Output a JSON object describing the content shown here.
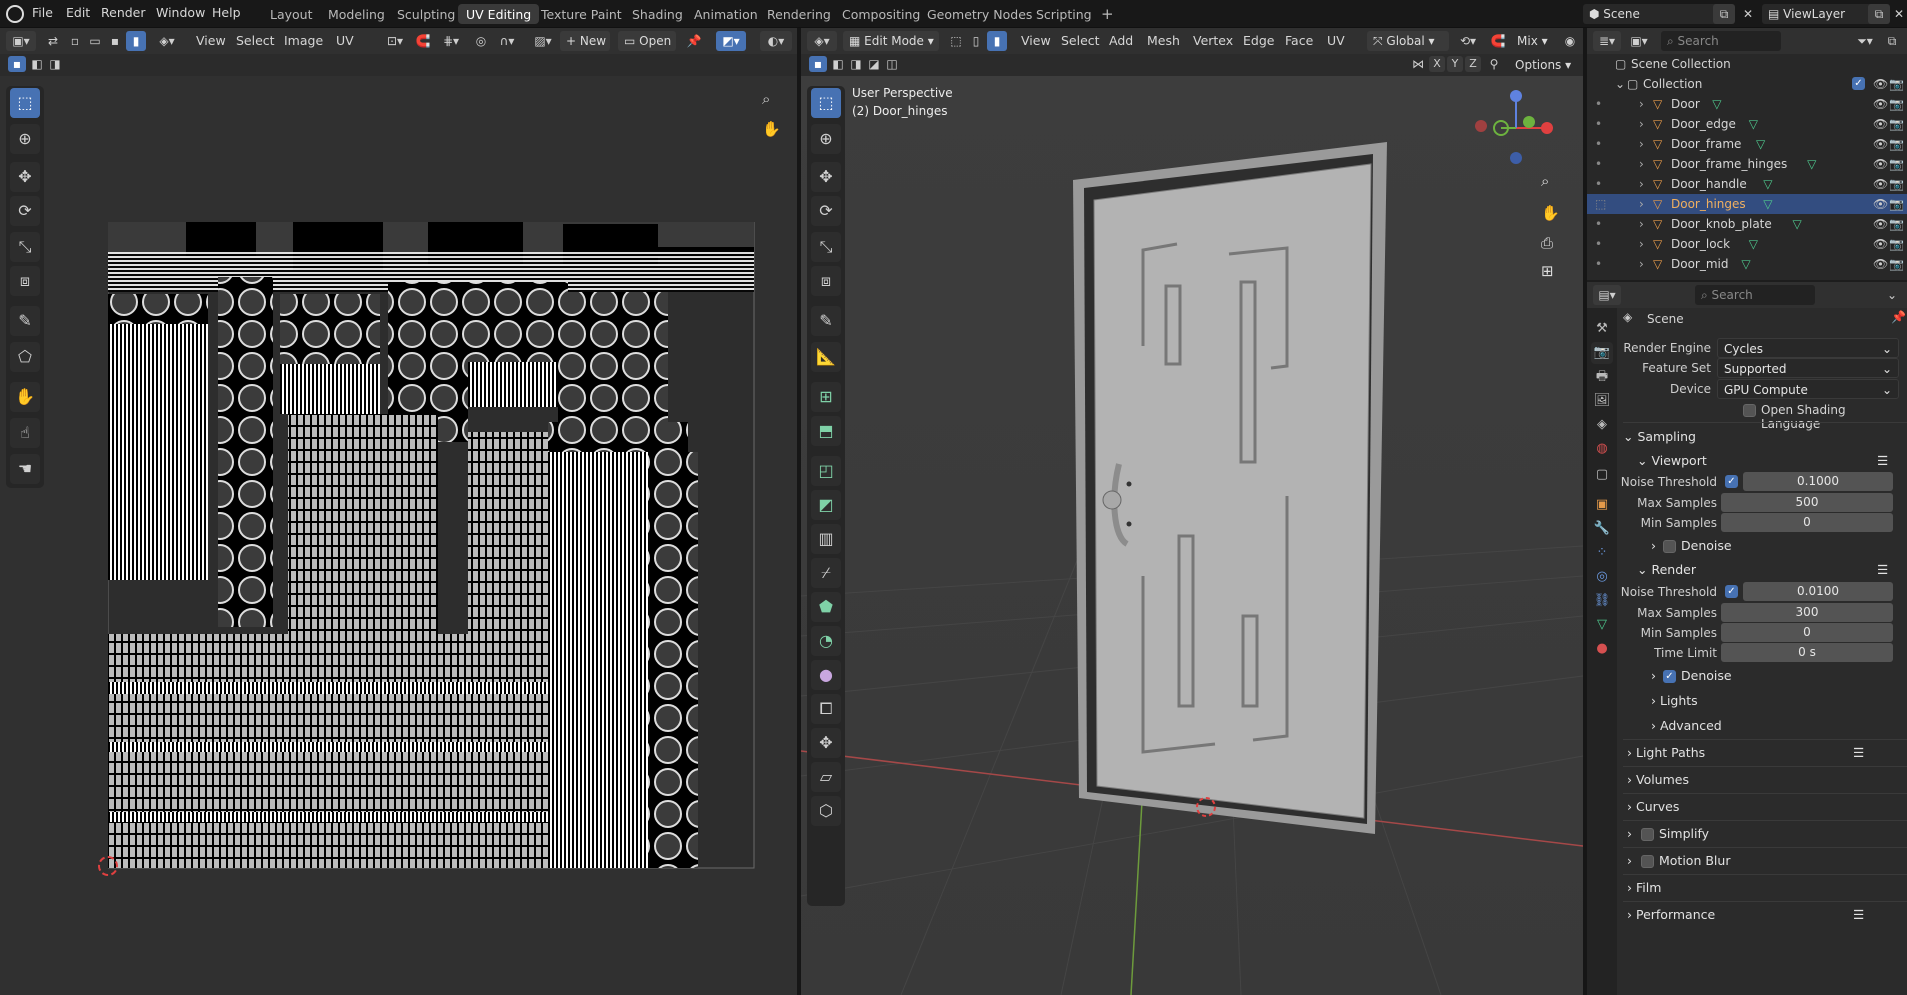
{
  "menu": {
    "file": "File",
    "edit": "Edit",
    "render": "Render",
    "window": "Window",
    "help": "Help"
  },
  "workspaces": [
    "Layout",
    "Modeling",
    "Sculpting",
    "UV Editing",
    "Texture Paint",
    "Shading",
    "Animation",
    "Rendering",
    "Compositing",
    "Geometry Nodes",
    "Scripting"
  ],
  "active_workspace": "UV Editing",
  "scene_name": "Scene",
  "view_layer": "ViewLayer",
  "uv_editor": {
    "menus": [
      "View",
      "Select",
      "Image",
      "UV"
    ],
    "new_label": "New",
    "open_label": "Open"
  },
  "viewport": {
    "mode": "Edit Mode",
    "menus": [
      "View",
      "Select",
      "Add",
      "Mesh",
      "Vertex",
      "Edge",
      "Face",
      "UV"
    ],
    "orientation": "Global",
    "shading_mix": "Mix",
    "axes": [
      "X",
      "Y",
      "Z"
    ],
    "options_label": "Options",
    "overlay_line1": "User Perspective",
    "overlay_line2": "(2) Door_hinges"
  },
  "outliner": {
    "search_placeholder": "Search",
    "scene_collection": "Scene Collection",
    "collection": "Collection",
    "items": [
      "Door",
      "Door_edge",
      "Door_frame",
      "Door_frame_hinges",
      "Door_handle",
      "Door_hinges",
      "Door_knob_plate",
      "Door_lock",
      "Door_mid"
    ],
    "selected": "Door_hinges"
  },
  "properties": {
    "search_placeholder": "Search",
    "context": "Scene",
    "render_engine_label": "Render Engine",
    "render_engine": "Cycles",
    "feature_set_label": "Feature Set",
    "feature_set": "Supported",
    "device_label": "Device",
    "device": "GPU Compute",
    "osl_label": "Open Shading Language",
    "sampling": "Sampling",
    "viewport": "Viewport",
    "noise_threshold_label": "Noise Threshold",
    "vp_noise_threshold": "0.1000",
    "max_samples_label": "Max Samples",
    "vp_max_samples": "500",
    "min_samples_label": "Min Samples",
    "vp_min_samples": "0",
    "denoise_label": "Denoise",
    "render": "Render",
    "r_noise_threshold": "0.0100",
    "r_max_samples": "300",
    "r_min_samples": "0",
    "time_limit_label": "Time Limit",
    "r_time_limit": "0 s",
    "lights": "Lights",
    "advanced": "Advanced",
    "light_paths": "Light Paths",
    "volumes": "Volumes",
    "curves": "Curves",
    "simplify": "Simplify",
    "motion_blur": "Motion Blur",
    "film": "Film",
    "performance": "Performance"
  },
  "colors": {
    "accent": "#4772b3",
    "selected_row": "#334d80",
    "object_orange": "#e59a4a",
    "mesh_green": "#4ec68c"
  }
}
